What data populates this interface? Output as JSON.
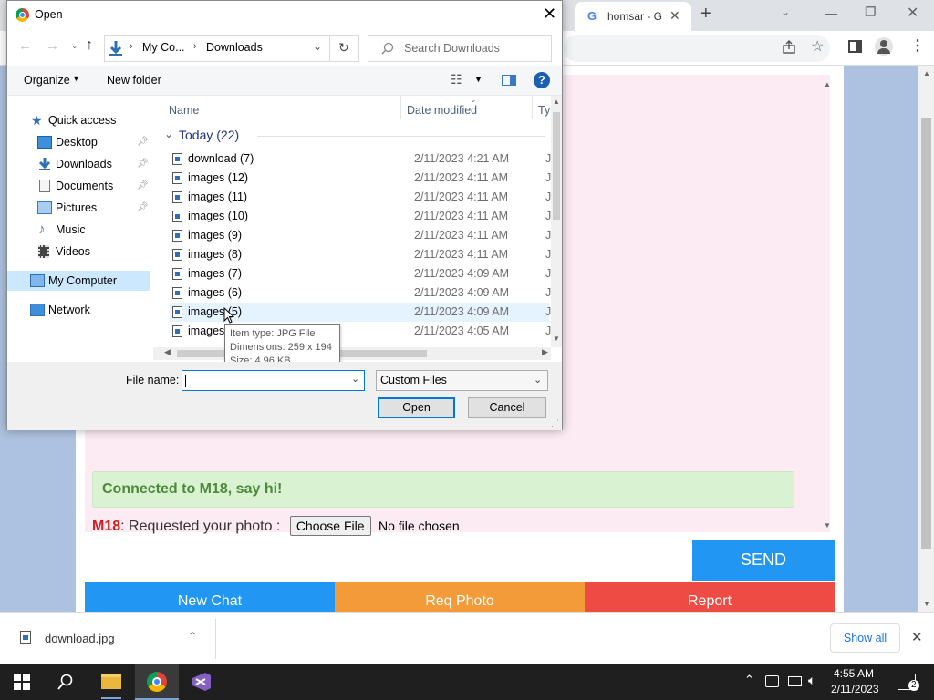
{
  "browser": {
    "tab_title": "homsar - G",
    "new_tab_symbol": "+"
  },
  "chat": {
    "connected_text": "Connected to M18, say hi!",
    "request_user": "M18",
    "request_text": ": Requested your photo :",
    "choose_file_label": "Choose File",
    "no_file_label": "No file chosen",
    "send_label": "SEND",
    "new_chat_label": "New Chat",
    "req_photo_label": "Req Photo",
    "report_label": "Report",
    "colors": {
      "send": "#2196f3",
      "new_chat": "#2196f3",
      "req_photo": "#f39a39",
      "report": "#ee4b45",
      "connected_bg": "#d9f2d2",
      "user_name": "#d81b1b"
    }
  },
  "downloads": {
    "file_name": "download.jpg",
    "show_all_label": "Show all"
  },
  "taskbar": {
    "time": "4:55 AM",
    "date": "2/11/2023",
    "notification_count": "2"
  },
  "dialog": {
    "title": "Open",
    "breadcrumb": [
      "My Co...",
      "Downloads"
    ],
    "search_placeholder": "Search Downloads",
    "organize_label": "Organize",
    "new_folder_label": "New folder",
    "nav": {
      "quick_access": "Quick access",
      "desktop": "Desktop",
      "downloads": "Downloads",
      "documents": "Documents",
      "pictures": "Pictures",
      "music": "Music",
      "videos": "Videos",
      "my_computer": "My Computer",
      "network": "Network"
    },
    "columns": {
      "name": "Name",
      "date": "Date modified",
      "type": "Ty"
    },
    "group_label": "Today (22)",
    "files": [
      {
        "name": "download (7)",
        "date": "2/11/2023 4:21 AM",
        "type": "JP"
      },
      {
        "name": "images (12)",
        "date": "2/11/2023 4:11 AM",
        "type": "JP"
      },
      {
        "name": "images (11)",
        "date": "2/11/2023 4:11 AM",
        "type": "JP"
      },
      {
        "name": "images (10)",
        "date": "2/11/2023 4:11 AM",
        "type": "JP"
      },
      {
        "name": "images (9)",
        "date": "2/11/2023 4:11 AM",
        "type": "JP"
      },
      {
        "name": "images (8)",
        "date": "2/11/2023 4:11 AM",
        "type": "JP"
      },
      {
        "name": "images (7)",
        "date": "2/11/2023 4:09 AM",
        "type": "JP"
      },
      {
        "name": "images (6)",
        "date": "2/11/2023 4:09 AM",
        "type": "JP"
      },
      {
        "name": "images (5)",
        "date": "2/11/2023 4:09 AM",
        "type": "JP"
      },
      {
        "name": "images",
        "date": "2/11/2023 4:05 AM",
        "type": "JP"
      }
    ],
    "tooltip": {
      "item_type": "Item type: JPG File",
      "dimensions": "Dimensions: 259 x 194",
      "size": "Size: 4.96 KB"
    },
    "file_name_label": "File name:",
    "file_name_value": "",
    "file_type_value": "Custom Files",
    "open_label": "Open",
    "cancel_label": "Cancel"
  }
}
